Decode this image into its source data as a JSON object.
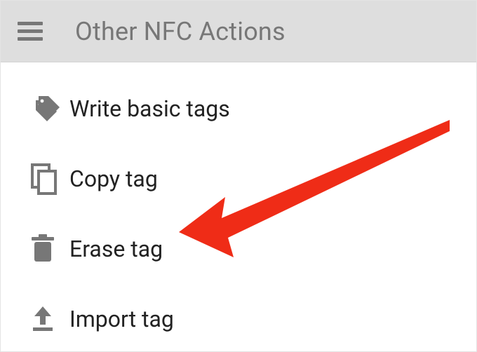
{
  "header": {
    "title": "Other NFC Actions"
  },
  "menu": {
    "items": [
      {
        "icon": "tags-icon",
        "label": "Write basic tags"
      },
      {
        "icon": "copy-icon",
        "label": "Copy tag"
      },
      {
        "icon": "trash-icon",
        "label": "Erase tag"
      },
      {
        "icon": "import-icon",
        "label": "Import tag"
      }
    ]
  },
  "annotation": {
    "arrow": {
      "color": "#ef2c17",
      "target": "erase-tag"
    }
  }
}
